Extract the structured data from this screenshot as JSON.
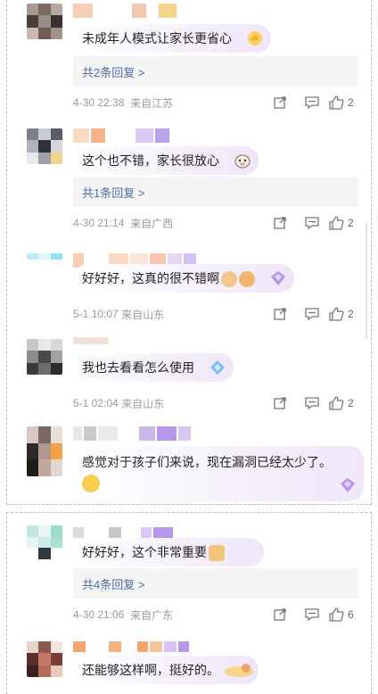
{
  "colors": {
    "reply_link": "#4a6ea9",
    "meta_text": "#9a9a9a",
    "bubble_tint": "#efe6fa"
  },
  "comments": [
    {
      "text": "未成年人模式让家长更省心",
      "reply_label": "共2条回复 >",
      "time": "4-30 22:38",
      "location": "来自江苏",
      "likes": "2"
    },
    {
      "text": "这个也不错，家长很放心",
      "reply_label": "共1条回复 >",
      "time": "4-30 21:14",
      "location": "来自广西",
      "likes": "2"
    },
    {
      "text": "好好好，这真的很不错啊",
      "time": "5-1 10:07",
      "location": "来自山东",
      "likes": "2"
    },
    {
      "text": "我也去看看怎么使用",
      "time": "5-1 02:04",
      "location": "来自山东",
      "likes": "2"
    },
    {
      "text": "感觉对于孩子们来说，现在漏洞已经太少了。"
    },
    {
      "text": "好好好，这个非常重要",
      "reply_label": "共4条回复 >",
      "time": "4-30 21:06",
      "location": "来自广东",
      "likes": "6"
    },
    {
      "text": "还能够这样啊，挺好的。"
    }
  ],
  "icons": {
    "share": "share-icon",
    "comment": "comment-icon",
    "like": "thumbs-up-icon"
  }
}
